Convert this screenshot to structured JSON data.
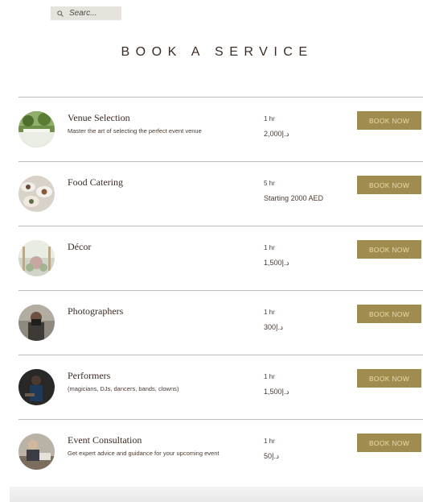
{
  "search": {
    "placeholder": "Searc..."
  },
  "page": {
    "title": "BOOK A SERVICE"
  },
  "colors": {
    "button": "#a08c4f",
    "button_text": "#e8dcb0",
    "divider": "#bdbdbd"
  },
  "services": [
    {
      "name": "Venue Selection",
      "description": "Master the art of selecting the perfect event venue",
      "duration": "1 hr",
      "price": "د.إ2,000",
      "button": "BOOK NOW",
      "image": "venue-photo"
    },
    {
      "name": "Food Catering",
      "description": "",
      "duration": "5 hr",
      "price": "Starting 2000 AED",
      "button": "BOOK NOW",
      "image": "catering-photo"
    },
    {
      "name": "Décor",
      "description": "",
      "duration": "1 hr",
      "price": "د.إ1,500",
      "button": "BOOK NOW",
      "image": "decor-photo"
    },
    {
      "name": "Photographers",
      "description": "",
      "duration": "1 hr",
      "price": "د.إ300",
      "button": "BOOK NOW",
      "image": "photographer-photo"
    },
    {
      "name": "Performers",
      "description": "(magicians, DJs, dancers, bands, clowns)",
      "duration": "1 hr",
      "price": "د.إ1,500",
      "button": "BOOK NOW",
      "image": "performer-photo"
    },
    {
      "name": "Event Consultation",
      "description": "Get expert advice and guidance for your upcoming event",
      "duration": "1 hr",
      "price": "د.إ50",
      "button": "BOOK NOW",
      "image": "consultation-photo"
    }
  ]
}
